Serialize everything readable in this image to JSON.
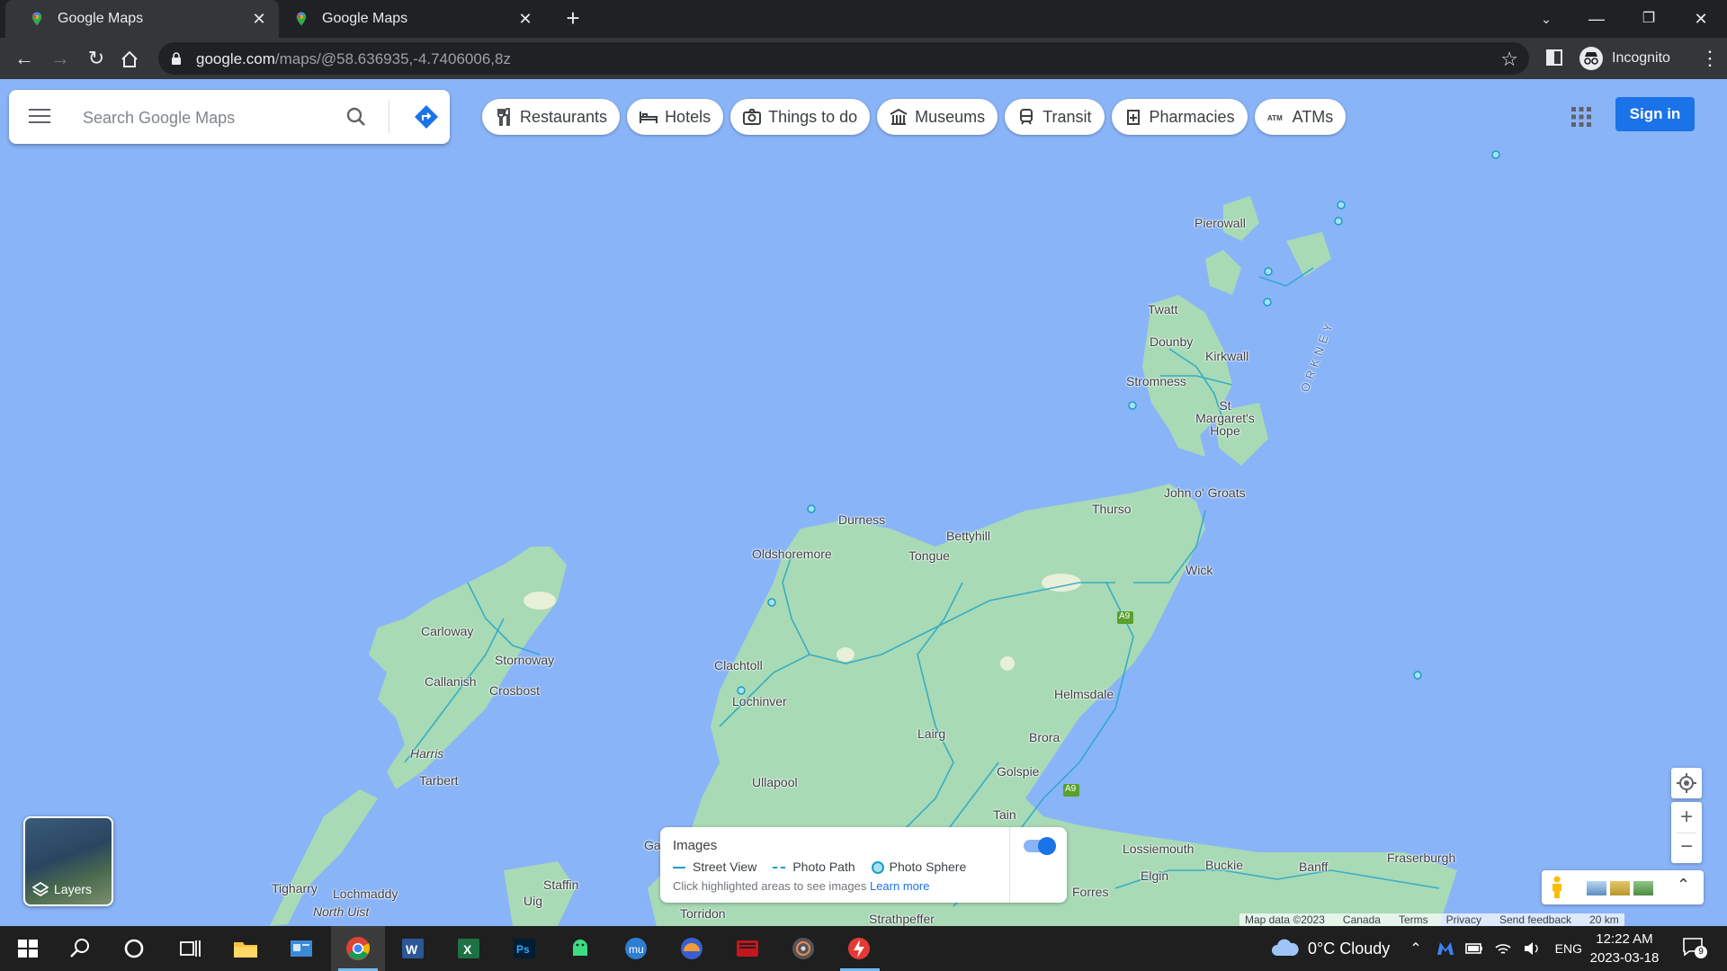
{
  "browser": {
    "tabs": [
      {
        "title": "Google Maps",
        "active": true
      },
      {
        "title": "Google Maps",
        "active": false
      }
    ],
    "url_domain": "google.com",
    "url_path": "/maps/@58.636935,-4.7406006,8z",
    "profile_label": "Incognito"
  },
  "maps": {
    "search_placeholder": "Search Google Maps",
    "chips": [
      {
        "label": "Restaurants",
        "icon": "fork-knife-icon"
      },
      {
        "label": "Hotels",
        "icon": "bed-icon"
      },
      {
        "label": "Things to do",
        "icon": "camera-icon"
      },
      {
        "label": "Museums",
        "icon": "museum-icon"
      },
      {
        "label": "Transit",
        "icon": "train-icon"
      },
      {
        "label": "Pharmacies",
        "icon": "pharmacy-icon"
      },
      {
        "label": "ATMs",
        "icon": "atm-icon"
      }
    ],
    "sign_in_label": "Sign in",
    "layers_label": "Layers",
    "images_panel": {
      "title": "Images",
      "legend": [
        "Street View",
        "Photo Path",
        "Photo Sphere"
      ],
      "hint": "Click highlighted areas to see images",
      "learn_more": "Learn more"
    },
    "footer": [
      "Map data ©2023",
      "Canada",
      "Terms",
      "Privacy",
      "Send feedback",
      "20 km"
    ],
    "places": [
      "Pierowall",
      "Twatt",
      "Dounby",
      "Kirkwall",
      "Stromness",
      "St Margaret's Hope",
      "ORKNEY",
      "John o' Groats",
      "Thurso",
      "Wick",
      "Durness",
      "Bettyhill",
      "Tongue",
      "Oldshoremore",
      "Carloway",
      "Stornoway",
      "Callanish",
      "Crosbost",
      "Harris",
      "Tarbert",
      "Clachtoll",
      "Lochinver",
      "Lairg",
      "Brora",
      "Helmsdale",
      "Golspie",
      "Ullapool",
      "Tain",
      "Lossiemouth",
      "Buckie",
      "Banff",
      "Fraserburgh",
      "Elgin",
      "Forres",
      "Tigharry",
      "Lochmaddy",
      "North Uist",
      "Staffin",
      "Uig",
      "Torridon",
      "Strathpeffer",
      "Ga"
    ],
    "road_labels": [
      "A9",
      "A9",
      "A9"
    ]
  },
  "taskbar": {
    "weather": "0°C  Cloudy",
    "language": "ENG",
    "time": "12:22 AM",
    "date": "2023-03-18",
    "notification_count": "9"
  }
}
